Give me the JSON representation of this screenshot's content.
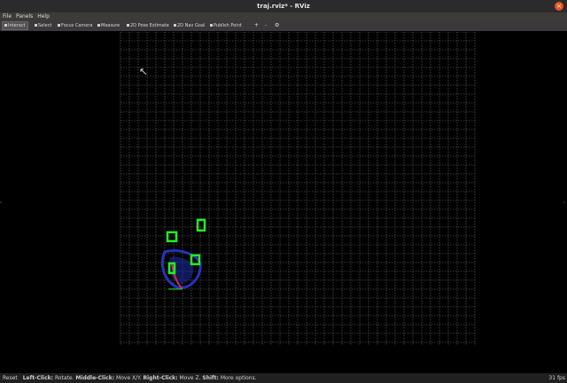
{
  "window": {
    "title": "traj.rviz* - RViz",
    "close_glyph": "×"
  },
  "menu": {
    "items": [
      "File",
      "Panels",
      "Help"
    ]
  },
  "toolbar": {
    "tools": [
      {
        "label": "Interact",
        "icon": "interact-icon",
        "active": true
      },
      {
        "label": "Select",
        "icon": "select-icon",
        "active": false
      },
      {
        "label": "Focus Camera",
        "icon": "focus-camera-icon",
        "active": false
      },
      {
        "label": "Measure",
        "icon": "measure-icon",
        "active": false
      },
      {
        "label": "2D Pose Estimate",
        "icon": "pose-estimate-icon",
        "active": false
      },
      {
        "label": "2D Nav Goal",
        "icon": "nav-goal-icon",
        "active": false
      },
      {
        "label": "Publish Point",
        "icon": "publish-point-icon",
        "active": false
      }
    ],
    "extra_icons": [
      "add-tool-icon",
      "remove-tool-icon",
      "tool-properties-icon"
    ]
  },
  "status": {
    "reset": "Reset",
    "left_click_key": "Left-Click:",
    "left_click_action": "Rotate.",
    "middle_click_key": "Middle-Click:",
    "middle_click_action": "Move X/Y.",
    "right_click_key": "Right-Click:",
    "right_click_action": "Move Z.",
    "shift_key": "Shift:",
    "shift_action": "More options.",
    "fps": "31 fps"
  },
  "colors": {
    "grid": "#6f6f6f",
    "marker_green": "#22ee22",
    "trajectory_blue": "#2a3bd8",
    "trajectory_red": "#c0304a",
    "background": "#000000"
  }
}
